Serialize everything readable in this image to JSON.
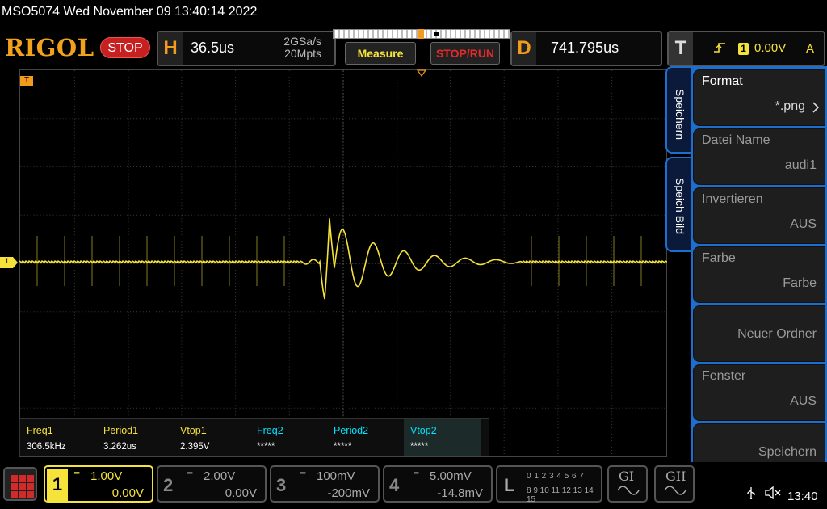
{
  "header": {
    "title": "MSO5074  Wed November 09 13:40:14 2022"
  },
  "topbar": {
    "brand": "RIGOL",
    "run_state": "STOP",
    "horizontal": {
      "letter": "H",
      "timebase": "36.5us",
      "sample_rate": "2GSa/s",
      "mem_depth": "20Mpts"
    },
    "measure_label": "Measure",
    "stoprun_label": "STOP/RUN",
    "delay": {
      "letter": "D",
      "value": "741.795us"
    },
    "trigger": {
      "letter": "T",
      "edge_icon": "rising-edge-icon",
      "source": "1",
      "level": "0.00V",
      "mode": "A"
    }
  },
  "colors": {
    "ch1": "#f5e23a",
    "ch2": "#00e5ff",
    "accent": "#f29b1d",
    "menu_blue": "#1d6fcf",
    "stop_red": "#c62020"
  },
  "screen": {
    "trigger_level_marker": "T",
    "ch1_marker": "1"
  },
  "measurements": [
    {
      "label": "Freq1",
      "value": "306.5kHz",
      "channel": "1"
    },
    {
      "label": "Period1",
      "value": "3.262us",
      "channel": "1"
    },
    {
      "label": "Vtop1",
      "value": "2.395V",
      "channel": "1"
    },
    {
      "label": "Freq2",
      "value": "*****",
      "channel": "2"
    },
    {
      "label": "Period2",
      "value": "*****",
      "channel": "2"
    },
    {
      "label": "Vtop2",
      "value": "*****",
      "channel": "2"
    }
  ],
  "side_tabs": [
    {
      "label": "Speichern"
    },
    {
      "label": "Speich Bild"
    }
  ],
  "menu": {
    "items": [
      {
        "label": "Format",
        "value": "*.png"
      },
      {
        "label": "Datei Name",
        "value": "audi1"
      },
      {
        "label": "Invertieren",
        "value": "AUS"
      },
      {
        "label": "Farbe",
        "value": "Farbe"
      },
      {
        "label": "",
        "value": "Neuer Ordner"
      },
      {
        "label": "Fenster",
        "value": "AUS"
      },
      {
        "label": "",
        "value": "Speichern"
      }
    ]
  },
  "bottom": {
    "channels": [
      {
        "num": "1",
        "scale": "1.00V",
        "offset": "0.00V",
        "active": true
      },
      {
        "num": "2",
        "scale": "2.00V",
        "offset": "0.00V",
        "active": false
      },
      {
        "num": "3",
        "scale": "100mV",
        "offset": "-200mV",
        "active": false
      },
      {
        "num": "4",
        "scale": "5.00mV",
        "offset": "-14.8mV",
        "active": false
      }
    ],
    "coupling_icon": "dc-coupling-icon",
    "logic": {
      "letter": "L",
      "row1": "0 1 2 3  4 5 6 7",
      "row2": "8 9 10 11 12 13 14 15"
    },
    "generators": [
      {
        "label": "GI"
      },
      {
        "label": "GII"
      }
    ],
    "usb_icon": "usb-icon",
    "speaker_icon": "speaker-muted-icon",
    "time": "13:40"
  }
}
